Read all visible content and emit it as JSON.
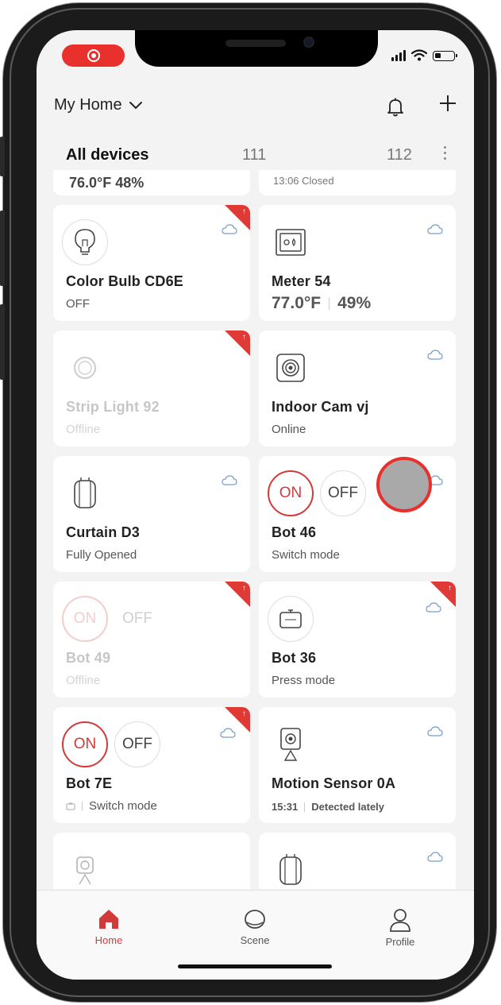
{
  "header": {
    "home_name": "My Home"
  },
  "tabs": [
    {
      "label": "All devices"
    },
    {
      "label": "111"
    },
    {
      "label": "112"
    }
  ],
  "partial_row": {
    "left_text": "76.0°F  48%",
    "right_text": "13:06  Closed"
  },
  "devices": [
    {
      "name": "Color Bulb CD6E",
      "status": "OFF",
      "icon": "bulb-icon"
    },
    {
      "name": "Meter 54",
      "temperature": "77.0°F",
      "humidity": "49%",
      "icon": "meter-icon"
    },
    {
      "name": "Strip Light 92",
      "status": "Offline",
      "icon": "strip-light-icon"
    },
    {
      "name": "Indoor Cam vj",
      "status": "Online",
      "icon": "camera-icon"
    },
    {
      "name": "Curtain D3",
      "status": "Fully Opened",
      "icon": "curtain-icon"
    },
    {
      "name": "Bot 46",
      "status": "Switch mode",
      "on_label": "ON",
      "off_label": "OFF"
    },
    {
      "name": "Bot 49",
      "status": "Offline",
      "on_label": "ON",
      "off_label": "OFF"
    },
    {
      "name": "Bot 36",
      "status": "Press mode",
      "icon": "bot-icon"
    },
    {
      "name": "Bot 7E",
      "status": "Switch mode",
      "on_label": "ON",
      "off_label": "OFF"
    },
    {
      "name": "Motion Sensor 0A",
      "time": "15:31",
      "status": "Detected lately",
      "icon": "motion-sensor-icon"
    }
  ],
  "tabbar": [
    {
      "label": "Home",
      "icon": "home-icon"
    },
    {
      "label": "Scene",
      "icon": "scene-icon"
    },
    {
      "label": "Profile",
      "icon": "profile-icon"
    }
  ],
  "colors": {
    "accent": "#d23a3a",
    "badge": "#e03a36",
    "recording": "#e8302c",
    "cloud": "#6f9fd0"
  }
}
